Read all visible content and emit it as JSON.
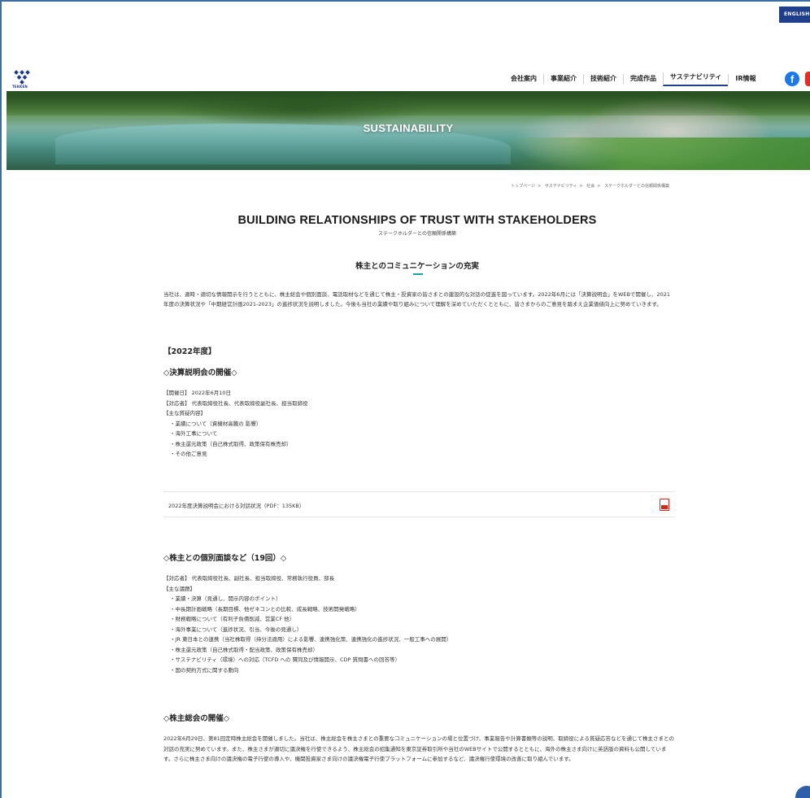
{
  "header": {
    "lang_button": "ENGLISH",
    "logo_text": "TEKKEN",
    "nav": [
      "会社案内",
      "事業紹介",
      "技術紹介",
      "完成作品",
      "サステナビリティ",
      "IR情報"
    ],
    "nav_active_index": 4,
    "social": [
      "facebook-icon",
      "youtube-icon"
    ],
    "colors": {
      "brand": "#1f3f8c",
      "facebook": "#1877f2",
      "youtube": "#e52d27",
      "accent": "#1aa3a0"
    }
  },
  "hero": {
    "title": "SUSTAINABILITY"
  },
  "breadcrumb": [
    "トップページ",
    "サステナビリティ",
    "社会",
    "ステークホルダーとの信頼関係構築"
  ],
  "page": {
    "title": "BUILDING RELATIONSHIPS OF TRUST WITH STAKEHOLDERS",
    "subtitle": "ステークホルダーとの信頼関係構築",
    "section_title": "株主とのコミュニケーションの充実",
    "intro": "当社は、適時・適切な情報開示を行うとともに、株主総会や個別面談、電話取材などを通じて株主・投資家の皆さまとの建設的な対話の促進を図っています。2022年6月には「決算説明会」をWEBで開催し、2021年度の決算状況や「中期経営計画2021-2023」の進捗状況を説明しました。今後も当社の業績や取り組みについて理解を深めていただくとともに、皆さまからのご意見を踏まえ企業価値向上に努めていきます。",
    "year_heading": "【2022年度】",
    "block1": {
      "heading": "◇決算説明会の開催◇",
      "lines": [
        "【開催日】 2022年6月10日",
        "【対応者】 代表取締役社長、代表取締役副社長、担当取締役",
        "【主な質疑内容】"
      ],
      "items": [
        "・業績について（資機材高騰の 影響）",
        "・海外工事について",
        "・株主還元政策（自己株式取得、政策保有株売却）",
        "・その他ご意見"
      ],
      "pdf_label": "2022年度決算説明会における対話状況（PDF：135KB）"
    },
    "block2": {
      "heading": "◇株主との個別面談など（19回）◇",
      "lines": [
        "【対応者】 代表取締役社長、副社長、担当取締役、常務執行役員、部長",
        "【主な議題】"
      ],
      "items": [
        "・業績・決算（見通し、開示内容のポイント）",
        "・中長期計画戦略（長期目標、他ゼネコンとの比較、成長戦略、技術開発戦略）",
        "・財務戦略について（有利子負債削減、営業CF 他）",
        "・海外事業について（進捗状況、引当、今後の見通し）",
        "・JR 東日本との連携（当社株取得（持分法適用）による影響、連携強化策、連携強化の進捗状況、一般工事への展開）",
        "・株主還元政策（自己株式取得・配当政策、政策保有株売却）",
        "・サステナビリティ（環境）への対応（TCFD への 賛同及び情報開示、CDP 質問書への回答等）",
        "・国の契約方式に関する動向"
      ]
    },
    "block3": {
      "heading": "◇株主総会の開催◇",
      "text": "2022年6月29日、第81回定時株主総会を開催しました。当社は、株主総会を株主さまとの重要なコミュニケーションの場と位置づけ、事業報告や計算書類等の説明、取締役による質疑応答などを通じて株主さまとの対話の充実に努めています。また、株主さまが適切に議決権を行使できるよう、株主総会の招集通知を東京証券取引所や当社のWEBサイトで公開するとともに、海外の株主さま向けに英語版の資料も公開しています。さらに株主さま向けの議決権の電子行使の導入や、機関投資家さま向けの議決権電子行使プラットフォームに参加するなど、議決権行使環境の改善に取り組んでいます。"
    }
  }
}
